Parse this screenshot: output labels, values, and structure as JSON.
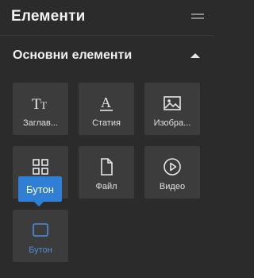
{
  "panel": {
    "title": "Елементи",
    "menu_icon": "hamburger-icon"
  },
  "section": {
    "title": "Основни елементи",
    "toggle_icon": "caret-up-icon"
  },
  "elements": [
    {
      "label": "Заглавие",
      "display_label": "Заглав...",
      "icon": "heading-icon"
    },
    {
      "label": "Статия",
      "display_label": "Статия",
      "icon": "text-icon"
    },
    {
      "label": "Изображение",
      "display_label": "Изобра...",
      "icon": "image-icon"
    },
    {
      "label": "",
      "display_label": "",
      "icon": "grid-icon"
    },
    {
      "label": "Файл",
      "display_label": "Файл",
      "icon": "file-icon"
    },
    {
      "label": "Видео",
      "display_label": "Видео",
      "icon": "play-circle-icon"
    },
    {
      "label": "Бутон",
      "display_label": "Бутон",
      "icon": "button-icon",
      "active": true
    }
  ],
  "tooltip": {
    "text": "Бутон"
  },
  "colors": {
    "background": "#2b2b2b",
    "tile": "#3c3c3c",
    "accent": "#2f7fd6",
    "active_text": "#4d8fdb"
  }
}
